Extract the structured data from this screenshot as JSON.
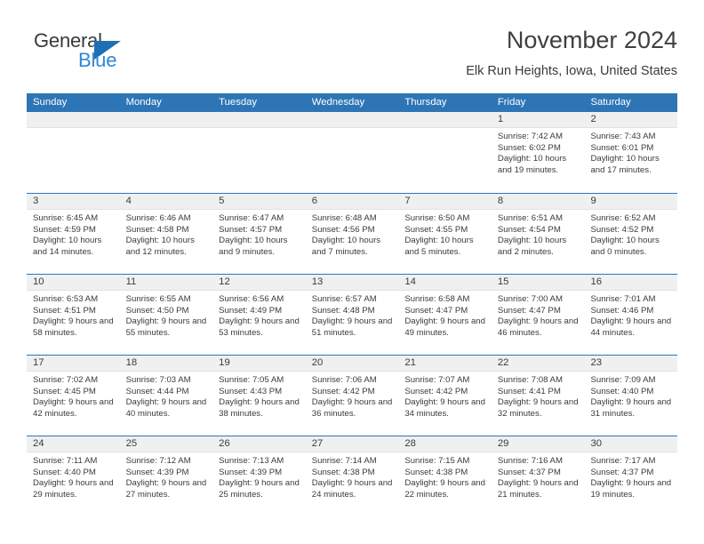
{
  "logo": {
    "word_one": "General",
    "word_two": "Blue",
    "triangle_color": "#1f6fb5",
    "word_two_color": "#2e87d8"
  },
  "header": {
    "title": "November 2024",
    "subtitle": "Elk Run Heights, Iowa, United States"
  },
  "theme": {
    "header_blue": "#2e75b6",
    "day_band_gray": "#f0f0f0",
    "text_color": "#3b3b3b"
  },
  "weekday_headers": [
    "Sunday",
    "Monday",
    "Tuesday",
    "Wednesday",
    "Thursday",
    "Friday",
    "Saturday"
  ],
  "weeks": [
    [
      {
        "empty": true
      },
      {
        "empty": true
      },
      {
        "empty": true
      },
      {
        "empty": true
      },
      {
        "empty": true
      },
      {
        "day": "1",
        "sunrise": "Sunrise: 7:42 AM",
        "sunset": "Sunset: 6:02 PM",
        "daylight": "Daylight: 10 hours and 19 minutes."
      },
      {
        "day": "2",
        "sunrise": "Sunrise: 7:43 AM",
        "sunset": "Sunset: 6:01 PM",
        "daylight": "Daylight: 10 hours and 17 minutes."
      }
    ],
    [
      {
        "day": "3",
        "sunrise": "Sunrise: 6:45 AM",
        "sunset": "Sunset: 4:59 PM",
        "daylight": "Daylight: 10 hours and 14 minutes."
      },
      {
        "day": "4",
        "sunrise": "Sunrise: 6:46 AM",
        "sunset": "Sunset: 4:58 PM",
        "daylight": "Daylight: 10 hours and 12 minutes."
      },
      {
        "day": "5",
        "sunrise": "Sunrise: 6:47 AM",
        "sunset": "Sunset: 4:57 PM",
        "daylight": "Daylight: 10 hours and 9 minutes."
      },
      {
        "day": "6",
        "sunrise": "Sunrise: 6:48 AM",
        "sunset": "Sunset: 4:56 PM",
        "daylight": "Daylight: 10 hours and 7 minutes."
      },
      {
        "day": "7",
        "sunrise": "Sunrise: 6:50 AM",
        "sunset": "Sunset: 4:55 PM",
        "daylight": "Daylight: 10 hours and 5 minutes."
      },
      {
        "day": "8",
        "sunrise": "Sunrise: 6:51 AM",
        "sunset": "Sunset: 4:54 PM",
        "daylight": "Daylight: 10 hours and 2 minutes."
      },
      {
        "day": "9",
        "sunrise": "Sunrise: 6:52 AM",
        "sunset": "Sunset: 4:52 PM",
        "daylight": "Daylight: 10 hours and 0 minutes."
      }
    ],
    [
      {
        "day": "10",
        "sunrise": "Sunrise: 6:53 AM",
        "sunset": "Sunset: 4:51 PM",
        "daylight": "Daylight: 9 hours and 58 minutes."
      },
      {
        "day": "11",
        "sunrise": "Sunrise: 6:55 AM",
        "sunset": "Sunset: 4:50 PM",
        "daylight": "Daylight: 9 hours and 55 minutes."
      },
      {
        "day": "12",
        "sunrise": "Sunrise: 6:56 AM",
        "sunset": "Sunset: 4:49 PM",
        "daylight": "Daylight: 9 hours and 53 minutes."
      },
      {
        "day": "13",
        "sunrise": "Sunrise: 6:57 AM",
        "sunset": "Sunset: 4:48 PM",
        "daylight": "Daylight: 9 hours and 51 minutes."
      },
      {
        "day": "14",
        "sunrise": "Sunrise: 6:58 AM",
        "sunset": "Sunset: 4:47 PM",
        "daylight": "Daylight: 9 hours and 49 minutes."
      },
      {
        "day": "15",
        "sunrise": "Sunrise: 7:00 AM",
        "sunset": "Sunset: 4:47 PM",
        "daylight": "Daylight: 9 hours and 46 minutes."
      },
      {
        "day": "16",
        "sunrise": "Sunrise: 7:01 AM",
        "sunset": "Sunset: 4:46 PM",
        "daylight": "Daylight: 9 hours and 44 minutes."
      }
    ],
    [
      {
        "day": "17",
        "sunrise": "Sunrise: 7:02 AM",
        "sunset": "Sunset: 4:45 PM",
        "daylight": "Daylight: 9 hours and 42 minutes."
      },
      {
        "day": "18",
        "sunrise": "Sunrise: 7:03 AM",
        "sunset": "Sunset: 4:44 PM",
        "daylight": "Daylight: 9 hours and 40 minutes."
      },
      {
        "day": "19",
        "sunrise": "Sunrise: 7:05 AM",
        "sunset": "Sunset: 4:43 PM",
        "daylight": "Daylight: 9 hours and 38 minutes."
      },
      {
        "day": "20",
        "sunrise": "Sunrise: 7:06 AM",
        "sunset": "Sunset: 4:42 PM",
        "daylight": "Daylight: 9 hours and 36 minutes."
      },
      {
        "day": "21",
        "sunrise": "Sunrise: 7:07 AM",
        "sunset": "Sunset: 4:42 PM",
        "daylight": "Daylight: 9 hours and 34 minutes."
      },
      {
        "day": "22",
        "sunrise": "Sunrise: 7:08 AM",
        "sunset": "Sunset: 4:41 PM",
        "daylight": "Daylight: 9 hours and 32 minutes."
      },
      {
        "day": "23",
        "sunrise": "Sunrise: 7:09 AM",
        "sunset": "Sunset: 4:40 PM",
        "daylight": "Daylight: 9 hours and 31 minutes."
      }
    ],
    [
      {
        "day": "24",
        "sunrise": "Sunrise: 7:11 AM",
        "sunset": "Sunset: 4:40 PM",
        "daylight": "Daylight: 9 hours and 29 minutes."
      },
      {
        "day": "25",
        "sunrise": "Sunrise: 7:12 AM",
        "sunset": "Sunset: 4:39 PM",
        "daylight": "Daylight: 9 hours and 27 minutes."
      },
      {
        "day": "26",
        "sunrise": "Sunrise: 7:13 AM",
        "sunset": "Sunset: 4:39 PM",
        "daylight": "Daylight: 9 hours and 25 minutes."
      },
      {
        "day": "27",
        "sunrise": "Sunrise: 7:14 AM",
        "sunset": "Sunset: 4:38 PM",
        "daylight": "Daylight: 9 hours and 24 minutes."
      },
      {
        "day": "28",
        "sunrise": "Sunrise: 7:15 AM",
        "sunset": "Sunset: 4:38 PM",
        "daylight": "Daylight: 9 hours and 22 minutes."
      },
      {
        "day": "29",
        "sunrise": "Sunrise: 7:16 AM",
        "sunset": "Sunset: 4:37 PM",
        "daylight": "Daylight: 9 hours and 21 minutes."
      },
      {
        "day": "30",
        "sunrise": "Sunrise: 7:17 AM",
        "sunset": "Sunset: 4:37 PM",
        "daylight": "Daylight: 9 hours and 19 minutes."
      }
    ]
  ]
}
